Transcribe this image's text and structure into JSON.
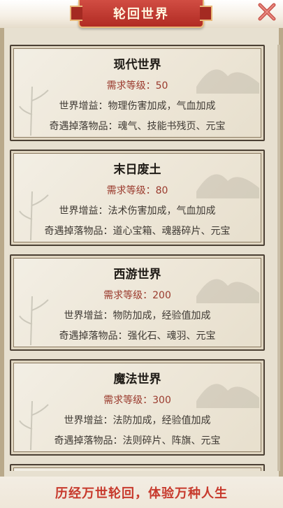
{
  "header": {
    "title": "轮回世界"
  },
  "worlds": [
    {
      "name": "现代世界",
      "level": "需求等级：50",
      "bonus": "世界增益：物理伤害加成，气血加成",
      "drops": "奇遇掉落物品：魂气、技能书残页、元宝"
    },
    {
      "name": "末日废土",
      "level": "需求等级：80",
      "bonus": "世界增益：法术伤害加成，气血加成",
      "drops": "奇遇掉落物品：道心宝箱、魂器碎片、元宝"
    },
    {
      "name": "西游世界",
      "level": "需求等级：200",
      "bonus": "世界增益：物防加成，经验值加成",
      "drops": "奇遇掉落物品：强化石、魂羽、元宝"
    },
    {
      "name": "魔法世界",
      "level": "需求等级：300",
      "bonus": "世界增益：法防加成，经验值加成",
      "drops": "奇遇掉落物品：法则碎片、阵旗、元宝"
    }
  ],
  "footer": {
    "slogan": "历经万世轮回，体验万种人生"
  },
  "colors": {
    "ribbon": "#c23a31",
    "level_text": "#9a3a2d",
    "slogan": "#c7392c"
  },
  "icons": {
    "close": "close-icon"
  }
}
